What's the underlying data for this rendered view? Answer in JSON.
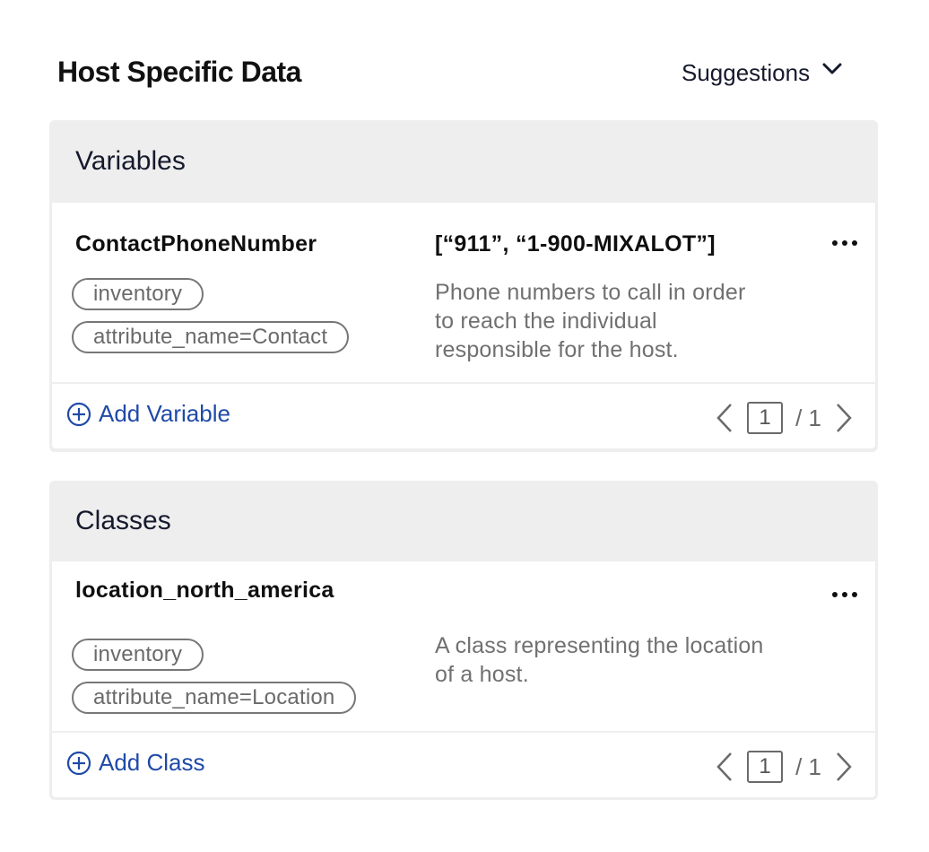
{
  "header": {
    "title": "Host Specific Data",
    "suggestions_label": "Suggestions",
    "suggestions_icon": "chevron-down-icon"
  },
  "variables": {
    "title": "Variables",
    "item": {
      "name": "ContactPhoneNumber",
      "value": "[“911”, “1-900-MIXALOT”]",
      "tags": [
        "inventory",
        "attribute_name=Contact"
      ],
      "description_lines": [
        "Phone numbers to call in order",
        "to reach the individual",
        "responsible for the host."
      ],
      "menu_icon": "kebab-icon"
    },
    "add_label": "Add Variable",
    "add_icon": "plus-circle-icon",
    "pagination": {
      "current": "1",
      "total": "/ 1"
    }
  },
  "classes": {
    "title": "Classes",
    "item": {
      "name": "location_north_america",
      "value": "",
      "tags": [
        "inventory",
        "attribute_name=Location"
      ],
      "description_lines": [
        "A class representing the location",
        "of a host."
      ],
      "menu_icon": "kebab-icon"
    },
    "add_label": "Add Class",
    "add_icon": "plus-circle-icon",
    "pagination": {
      "current": "1",
      "total": "/ 1"
    }
  },
  "colors": {
    "link": "#1f4aa8",
    "card_header_bg": "#eeeeee",
    "muted_text": "#707070"
  }
}
